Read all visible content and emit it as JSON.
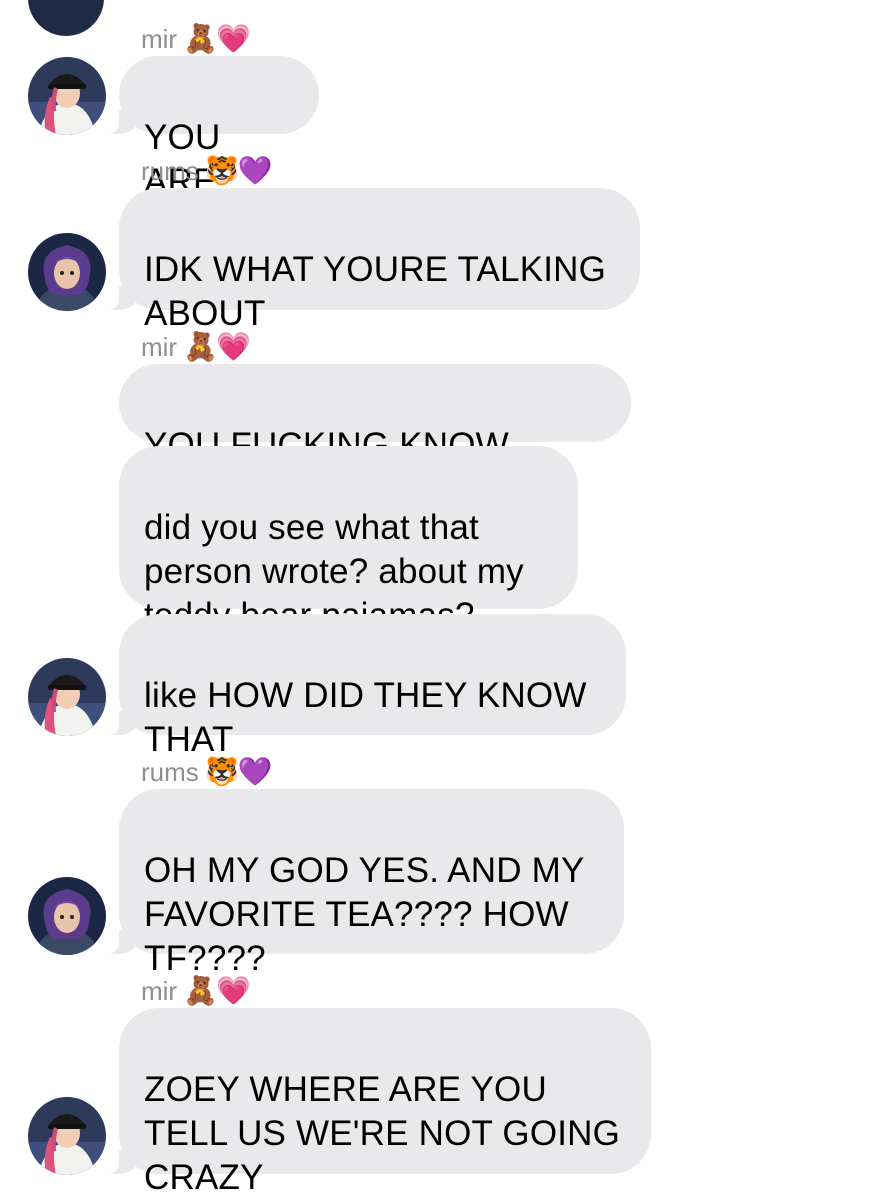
{
  "messages": [
    {
      "sender": "mir",
      "sender_emojis": "🧸💗",
      "avatar": "mir-avatar",
      "text": "YOU ARE"
    },
    {
      "sender": "rums",
      "sender_emojis": "🐯💜",
      "avatar": "rums-avatar",
      "text": "IDK WHAT YOURE TALKING\nABOUT"
    },
    {
      "sender": "mir",
      "sender_emojis": "🧸💗",
      "avatar": "mir-avatar",
      "text": "YOU FUCKING KNOW RUMI"
    },
    {
      "sender": "mir",
      "avatar": "mir-avatar",
      "text": "did you see what that\nperson wrote? about my\nteddy bear pajamas?"
    },
    {
      "sender": "mir",
      "avatar": "mir-avatar",
      "text": "like HOW DID THEY KNOW\nTHAT"
    },
    {
      "sender": "rums",
      "sender_emojis": "🐯💜",
      "avatar": "rums-avatar",
      "text": "OH MY GOD YES. AND MY\nFAVORITE TEA???? HOW\nTF????"
    },
    {
      "sender": "mir",
      "sender_emojis": "🧸💗",
      "avatar": "mir-avatar",
      "text": "ZOEY WHERE ARE YOU\nTELL US WE'RE NOT GOING\nCRAZY"
    }
  ],
  "colors": {
    "bubble": "#e9e9eb",
    "sender_label": "#8e8e93",
    "background": "#ffffff"
  }
}
